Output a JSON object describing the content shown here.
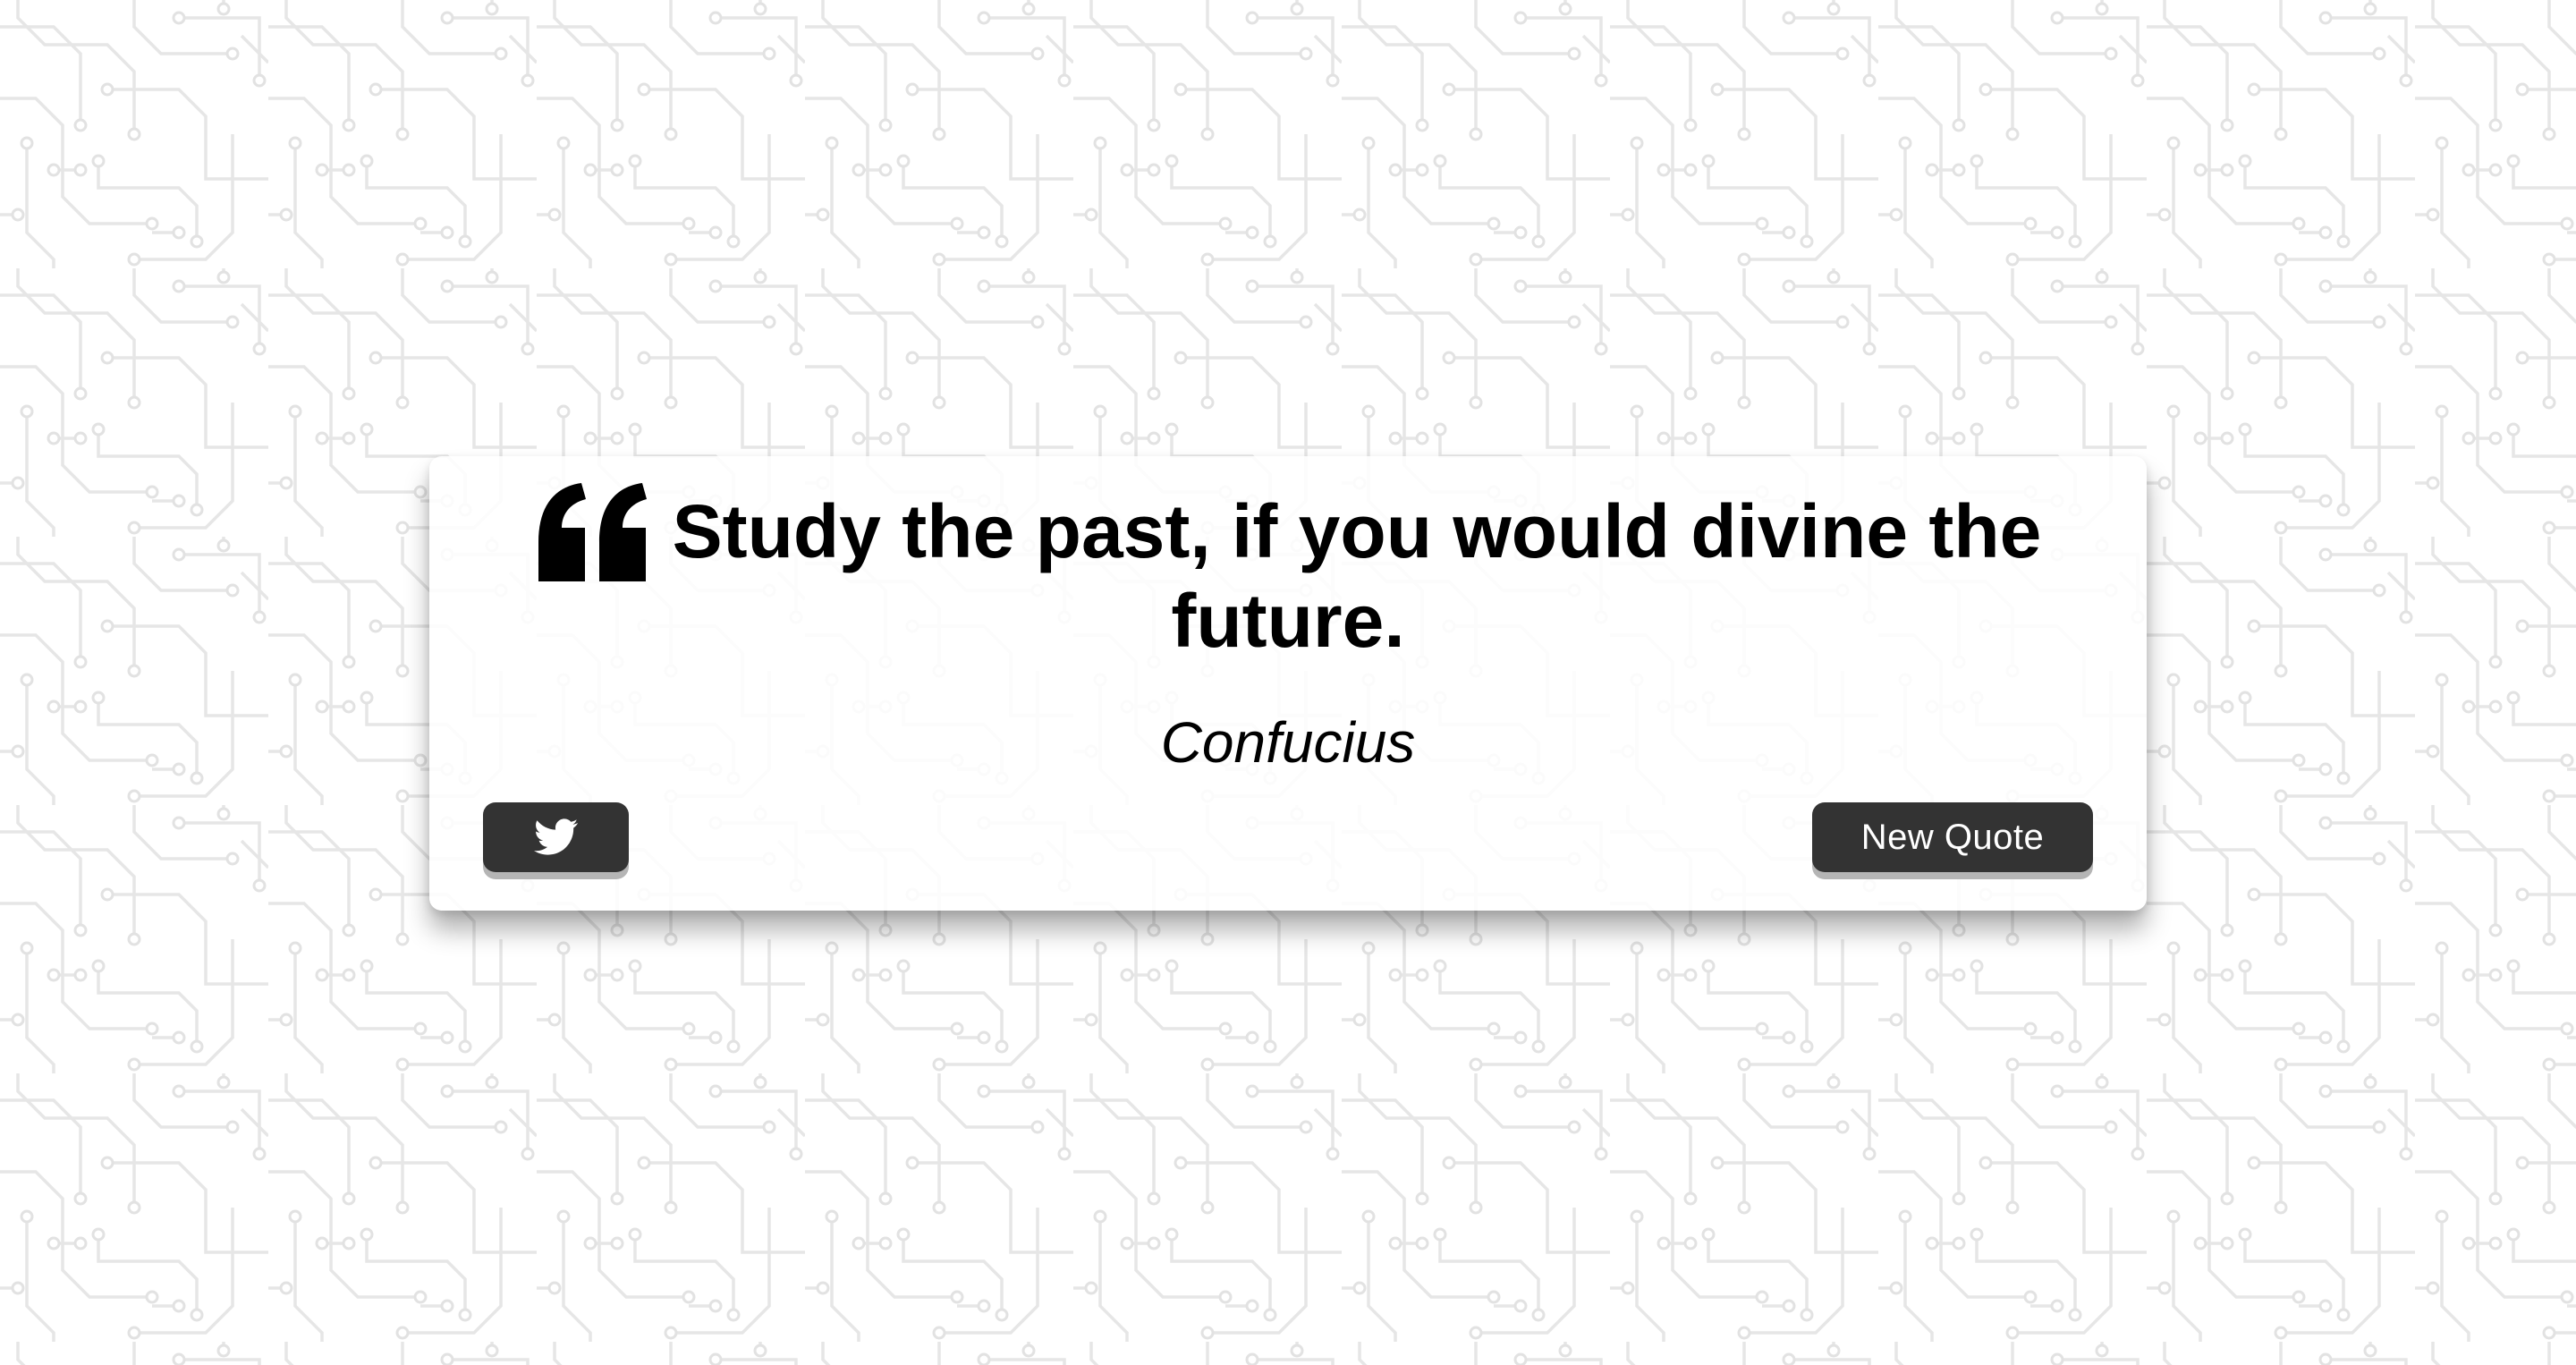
{
  "quote": {
    "text": "Study the past, if you would divine the future.",
    "author": "Confucius"
  },
  "buttons": {
    "tweet_icon": "twitter-icon",
    "new_quote_label": "New Quote"
  },
  "icons": {
    "quote_mark": "quote-left-icon"
  },
  "colors": {
    "button_background": "#333333",
    "button_text": "#ffffff",
    "text": "#000000",
    "card_background": "#ffffff"
  }
}
